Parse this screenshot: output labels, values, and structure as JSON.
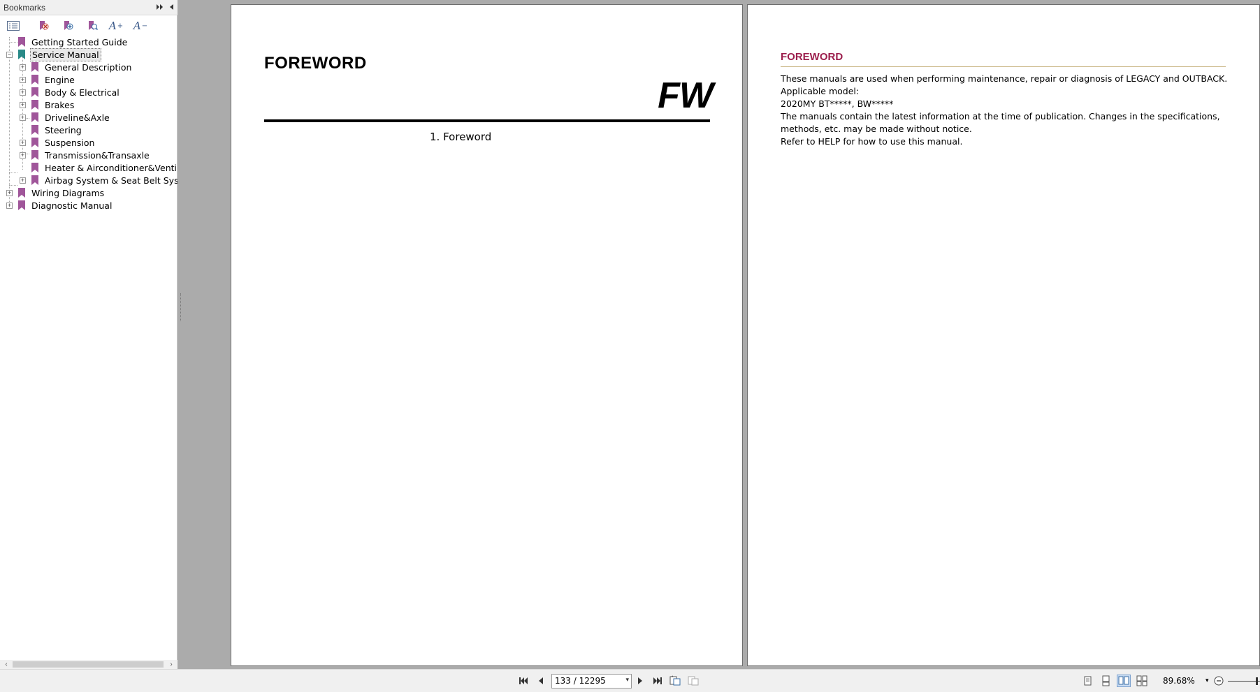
{
  "sidebar": {
    "title": "Bookmarks",
    "tree": [
      {
        "label": "Getting Started Guide"
      },
      {
        "label": "Service Manual",
        "selected": true
      },
      {
        "label": "General Description"
      },
      {
        "label": "Engine"
      },
      {
        "label": "Body & Electrical"
      },
      {
        "label": "Brakes"
      },
      {
        "label": "Driveline&Axle"
      },
      {
        "label": "Steering"
      },
      {
        "label": "Suspension"
      },
      {
        "label": "Transmission&Transaxle"
      },
      {
        "label": "Heater & Airconditioner&Ventilator"
      },
      {
        "label": "Airbag System & Seat Belt System"
      },
      {
        "label": "Wiring Diagrams"
      },
      {
        "label": "Diagnostic Manual"
      }
    ]
  },
  "page_left": {
    "title": "FOREWORD",
    "code": "FW",
    "toc_item": "1. Foreword"
  },
  "page_right": {
    "title": "FOREWORD",
    "lines": [
      "These manuals are used when performing maintenance, repair or diagnosis of LEGACY and OUTBACK.",
      "Applicable model:",
      "2020MY BT*****, BW*****",
      "The manuals contain the latest information at the time of publication. Changes in the specifications,",
      "methods, etc. may be made without notice.",
      "Refer to HELP for how to use this manual."
    ]
  },
  "statusbar": {
    "page_indicator": "133 / 12295",
    "zoom": "89.68%"
  },
  "colors": {
    "bookmark_purple": "#a0569a",
    "bookmark_teal": "#2a8a88",
    "heading_red": "#9c1f4d",
    "rule_gold": "#cbb98a"
  }
}
